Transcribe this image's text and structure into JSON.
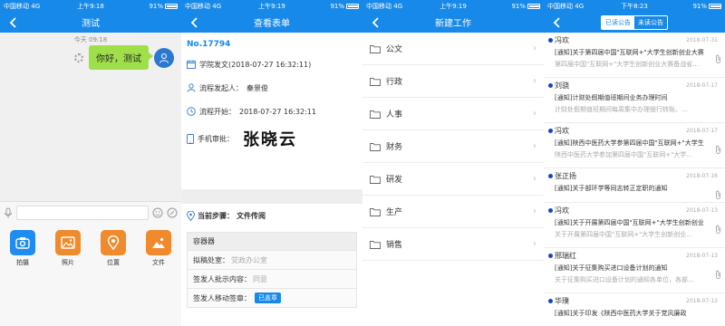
{
  "colors": {
    "primary": "#1789e8",
    "bubble": "#9fe04a",
    "dot": "#1744c6"
  },
  "status_bar": [
    {
      "carrier": "中国移动",
      "net": "4G",
      "time": "上午9:18",
      "battery": "91%"
    },
    {
      "carrier": "中国移动",
      "net": "4G",
      "time": "上午9:19",
      "battery": "91%"
    },
    {
      "carrier": "中国移动",
      "net": "4G",
      "time": "上午9:19",
      "battery": "91%"
    },
    {
      "carrier": "中国移动",
      "net": "4G",
      "time": "下午8:23",
      "battery": "91%"
    }
  ],
  "chat": {
    "title": "测试",
    "timestamp": "今天 09:18",
    "message": "你好，测试",
    "tools": [
      {
        "label": "拍摄",
        "icon": "camera-icon",
        "color": "#1e8cf0"
      },
      {
        "label": "照片",
        "icon": "photo-icon",
        "color": "#f08a2c"
      },
      {
        "label": "位置",
        "icon": "location-icon",
        "color": "#f08a2c"
      },
      {
        "label": "文件",
        "icon": "file-icon",
        "color": "#f08a2c"
      }
    ]
  },
  "form": {
    "title": "查看表单",
    "doc_no": "No.17794",
    "dispatch": "学院发文(2018-07-27 16:32:11)",
    "initiator_label": "流程发起人：",
    "initiator": "秦景俊",
    "start_label": "流程开始：",
    "start_time": "2018-07-27 16:32:11",
    "mobile_label": "手机审批：",
    "signature": "张晓云",
    "step_label": "当前步骤：",
    "step": "文件传阅",
    "container_title": "容器器",
    "fields": [
      {
        "k": "拟稿处室：",
        "v": "党政办公室"
      },
      {
        "k": "签发人批示内容：",
        "v": "同意"
      },
      {
        "k": "签发人移动签章：",
        "v": "",
        "btn": "已盖章"
      }
    ]
  },
  "new_work": {
    "title": "新建工作",
    "items": [
      "公文",
      "行政",
      "人事",
      "财务",
      "研发",
      "生产",
      "销售"
    ]
  },
  "notices": {
    "tab_read": "已读公告",
    "tab_unread": "未读公告",
    "items": [
      {
        "sender": "冯欢",
        "date": "2018-07-31",
        "subject": "[通知]关于第四届中国\"互联网+\"大学生创新创业大赛",
        "preview": "第四届中国\"互联网+\"大学生创新创业大赛备战省...",
        "attach": true
      },
      {
        "sender": "刘骁",
        "date": "2018-07-17",
        "subject": "[通知]计财处假期值班期间业务办理时间",
        "preview": "计财处假期值班期间每周集中办理银行转账、...",
        "attach": false
      },
      {
        "sender": "冯欢",
        "date": "2018-07-17",
        "subject": "[通知]陕西中医药大学参第四届中国\"互联网+\"大学生",
        "preview": "陕西中医药大学参加第四届中国\"互联网+\"大学...",
        "attach": true
      },
      {
        "sender": "张正扬",
        "date": "2018-07-16",
        "subject": "[通知]关于部环学等同志转正定职的通知",
        "preview": "",
        "attach": true
      },
      {
        "sender": "冯欢",
        "date": "2018-07-13",
        "subject": "[通知]关于开展第四届中国\"互联网+\"大学生创新创业",
        "preview": "关于开展第四届中国\"互联网+\"大学生创新创业...",
        "attach": true
      },
      {
        "sender": "邢瑞红",
        "date": "2018-07-13",
        "subject": "[通知]关于征集购买进口设备计划的通知",
        "preview": "关于征集购买进口设备计划的通知各单位，各部...",
        "attach": true
      },
      {
        "sender": "华璞",
        "date": "2018-07-12",
        "subject": "[通知]关于印发《陕西中医药大学关于党风廉政",
        "preview": "",
        "attach": false
      }
    ]
  }
}
